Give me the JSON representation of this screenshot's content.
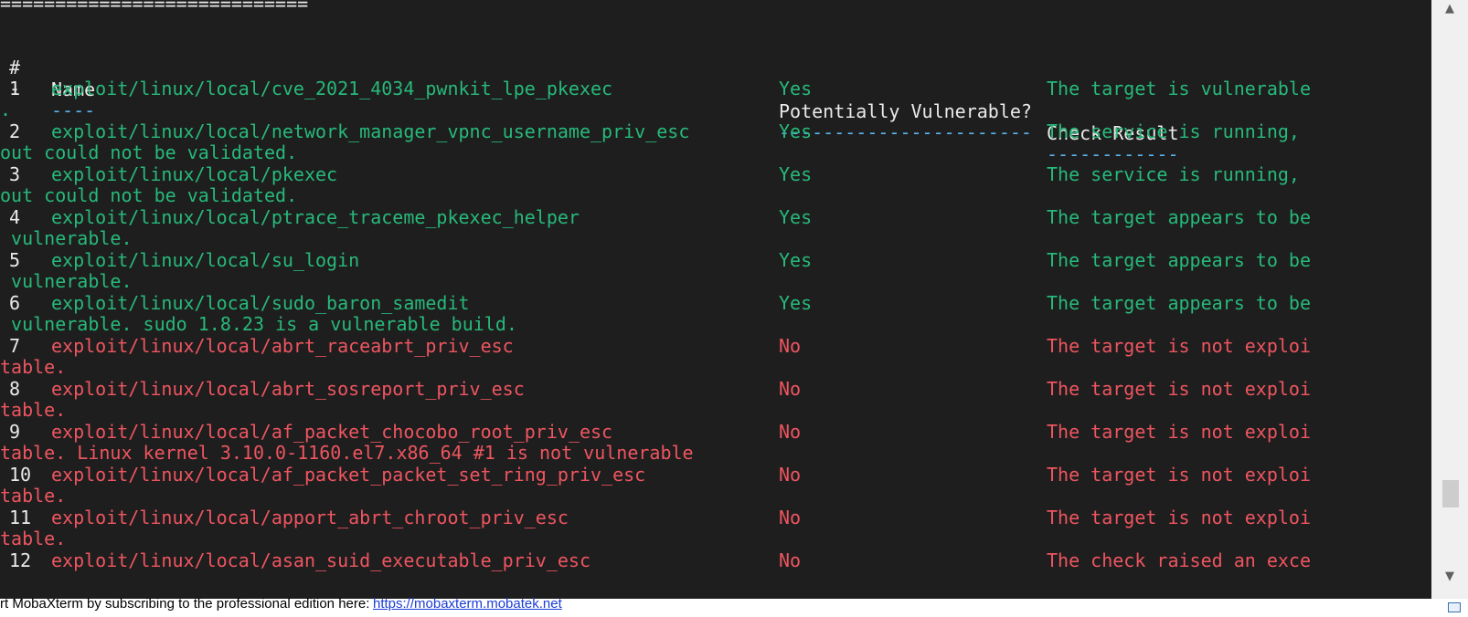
{
  "separator": "============================",
  "headers": {
    "num": "#",
    "name": "Name",
    "vuln": "Potentially Vulnerable?",
    "result": "Check Result"
  },
  "underlines": {
    "num": "-",
    "name": "----",
    "vuln": "-----------------------",
    "result": "------------"
  },
  "rows": [
    {
      "num": "1",
      "name": "exploit/linux/local/cve_2021_4034_pwnkit_lpe_pkexec",
      "vuln": "Yes",
      "result": "The target is vulnerable",
      "cont": "."
    },
    {
      "num": "2",
      "name": "exploit/linux/local/network_manager_vpnc_username_priv_esc",
      "vuln": "Yes",
      "result": "The service is running,",
      "cont": "out could not be validated."
    },
    {
      "num": "3",
      "name": "exploit/linux/local/pkexec",
      "vuln": "Yes",
      "result": "The service is running,",
      "cont": "out could not be validated."
    },
    {
      "num": "4",
      "name": "exploit/linux/local/ptrace_traceme_pkexec_helper",
      "vuln": "Yes",
      "result": "The target appears to be",
      "cont": " vulnerable."
    },
    {
      "num": "5",
      "name": "exploit/linux/local/su_login",
      "vuln": "Yes",
      "result": "The target appears to be",
      "cont": " vulnerable."
    },
    {
      "num": "6",
      "name": "exploit/linux/local/sudo_baron_samedit",
      "vuln": "Yes",
      "result": "The target appears to be",
      "cont": " vulnerable. sudo 1.8.23 is a vulnerable build."
    },
    {
      "num": "7",
      "name": "exploit/linux/local/abrt_raceabrt_priv_esc",
      "vuln": "No",
      "result": "The target is not exploi",
      "cont": "table."
    },
    {
      "num": "8",
      "name": "exploit/linux/local/abrt_sosreport_priv_esc",
      "vuln": "No",
      "result": "The target is not exploi",
      "cont": "table."
    },
    {
      "num": "9",
      "name": "exploit/linux/local/af_packet_chocobo_root_priv_esc",
      "vuln": "No",
      "result": "The target is not exploi",
      "cont": "table. Linux kernel 3.10.0-1160.el7.x86_64 #1 is not vulnerable"
    },
    {
      "num": "10",
      "name": "exploit/linux/local/af_packet_packet_set_ring_priv_esc",
      "vuln": "No",
      "result": "The target is not exploi",
      "cont": "table."
    },
    {
      "num": "11",
      "name": "exploit/linux/local/apport_abrt_chroot_priv_esc",
      "vuln": "No",
      "result": "The target is not exploi",
      "cont": "table."
    },
    {
      "num": "12",
      "name": "exploit/linux/local/asan_suid_executable_priv_esc",
      "vuln": "No",
      "result": "The check raised an exce",
      "cont": ""
    }
  ],
  "status": {
    "text": "rt MobaXterm by subscribing to the professional edition here:",
    "link": "https://mobaxterm.mobatek.net"
  },
  "colors": {
    "background": "#1e1e1e",
    "text": "#eaeaea",
    "vulnerable": "#27b97a",
    "not_vulnerable": "#ee5560",
    "underline": "#5ab4f0"
  },
  "icons": {
    "scroll_up": "▲",
    "scroll_down": "▼"
  }
}
